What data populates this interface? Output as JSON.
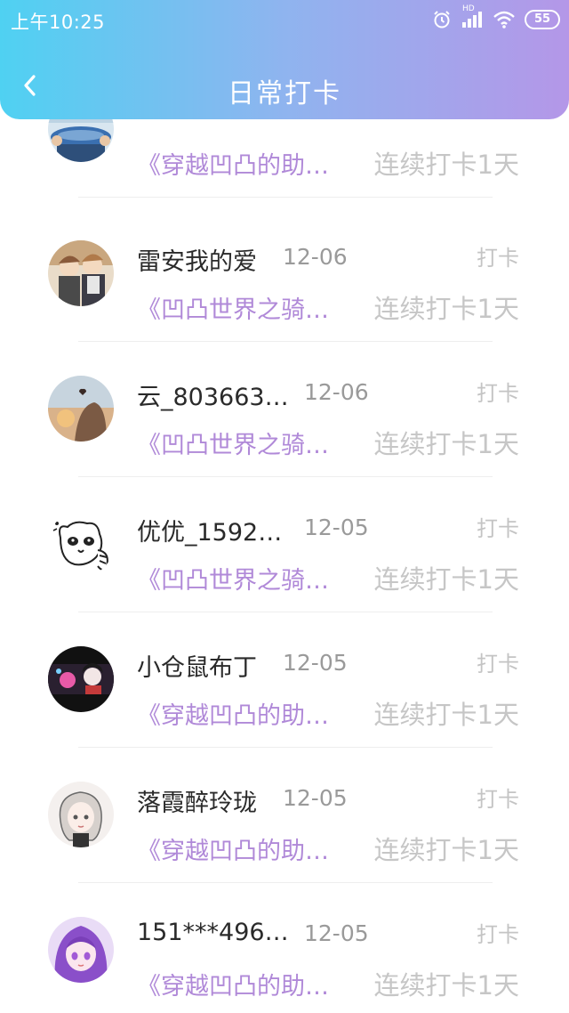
{
  "status_bar": {
    "time": "上午10:25",
    "network_label": "HD",
    "battery": "55"
  },
  "header": {
    "title": "日常打卡"
  },
  "colors": {
    "header_gradient_start": "#4fd1f2",
    "header_gradient_end": "#b497e8",
    "book_title": "#b089d8",
    "muted_text": "#c6c6c6"
  },
  "checkins": [
    {
      "name": "",
      "date": "",
      "action": "",
      "book": "《穿越凹凸的助…",
      "streak": "连续打卡1天",
      "avatar_icon": "fish-avatar-icon"
    },
    {
      "name": "雷安我的爱",
      "date": "12-06",
      "action": "打卡",
      "book": "《凹凸世界之骑…",
      "streak": "连续打卡1天",
      "avatar_icon": "anime-boy-avatar-icon"
    },
    {
      "name": "云_803663…",
      "date": "12-06",
      "action": "打卡",
      "book": "《凹凸世界之骑…",
      "streak": "连续打卡1天",
      "avatar_icon": "sunset-avatar-icon"
    },
    {
      "name": "优优_1592…",
      "date": "12-05",
      "action": "打卡",
      "book": "《凹凸世界之骑…",
      "streak": "连续打卡1天",
      "avatar_icon": "raccoon-avatar-icon"
    },
    {
      "name": "小仓鼠布丁",
      "date": "12-05",
      "action": "打卡",
      "book": "《穿越凹凸的助…",
      "streak": "连续打卡1天",
      "avatar_icon": "dark-anime-avatar-icon"
    },
    {
      "name": "落霞醉玲珑",
      "date": "12-05",
      "action": "打卡",
      "book": "《穿越凹凸的助…",
      "streak": "连续打卡1天",
      "avatar_icon": "sketch-girl-avatar-icon"
    },
    {
      "name": "151***496…",
      "date": "12-05",
      "action": "打卡",
      "book": "《穿越凹凸的助…",
      "streak": "连续打卡1天",
      "avatar_icon": "purple-hair-avatar-icon"
    }
  ]
}
